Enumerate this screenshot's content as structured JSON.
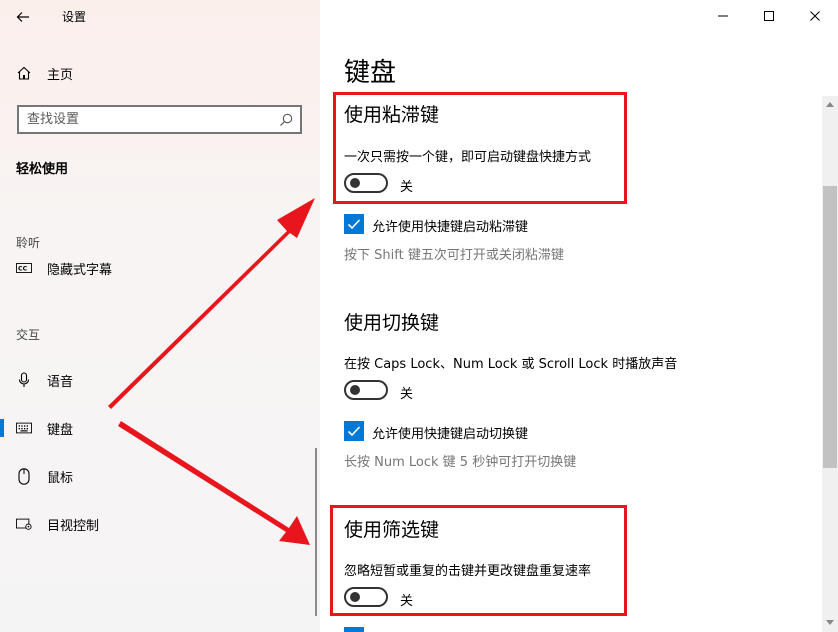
{
  "window": {
    "title": "设置",
    "minimize_icon": "minimize-icon",
    "maximize_icon": "maximize-icon",
    "close_icon": "close-icon"
  },
  "sidebar": {
    "home": {
      "label": "主页",
      "icon": "home-icon"
    },
    "search": {
      "placeholder": "查找设置",
      "icon": "search-icon"
    },
    "category_title": "轻松使用",
    "groups": [
      {
        "label": "聆听",
        "items": [
          {
            "label": "隐藏式字幕",
            "icon": "closed-caption-icon"
          }
        ]
      },
      {
        "label": "交互",
        "items": [
          {
            "label": "语音",
            "icon": "microphone-icon"
          },
          {
            "label": "键盘",
            "icon": "keyboard-icon",
            "active": true
          },
          {
            "label": "鼠标",
            "icon": "mouse-icon"
          },
          {
            "label": "目视控制",
            "icon": "eye-control-icon"
          }
        ]
      }
    ]
  },
  "main": {
    "title": "键盘",
    "sticky_keys": {
      "heading": "使用粘滞键",
      "description": "一次只需按一个键，即可启动键盘快捷方式",
      "toggle_state": "关",
      "checkbox_label": "允许使用快捷键启动粘滞键",
      "hint": "按下 Shift 键五次可打开或关闭粘滞键"
    },
    "toggle_keys": {
      "heading": "使用切换键",
      "description": "在按 Caps Lock、Num Lock 或 Scroll Lock 时播放声音",
      "toggle_state": "关",
      "checkbox_label": "允许使用快捷键启动切换键",
      "hint": "长按 Num Lock 键 5 秒钟可打开切换键"
    },
    "filter_keys": {
      "heading": "使用筛选键",
      "description": "忽略短暂或重复的击键并更改键盘重复速率",
      "toggle_state": "关"
    }
  },
  "colors": {
    "accent": "#0078d7",
    "annotation": "#e8161c",
    "sidebar_bg": "#f5f4f4"
  }
}
